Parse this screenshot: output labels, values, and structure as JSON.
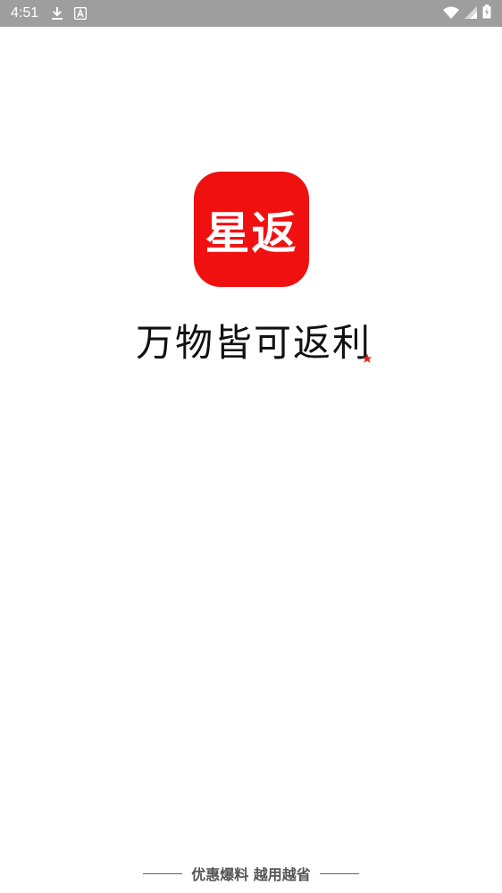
{
  "status_bar": {
    "time": "4:51",
    "icons": [
      "download-icon",
      "a-notification-icon",
      "wifi-icon",
      "signal-icon",
      "battery-charging-icon"
    ]
  },
  "logo": {
    "text": "星返",
    "background_color": "#f01010"
  },
  "slogan": {
    "text": "万物皆可返利",
    "accent_color": "#e11d1d"
  },
  "footer": {
    "text": "优惠爆料  越用越省"
  }
}
